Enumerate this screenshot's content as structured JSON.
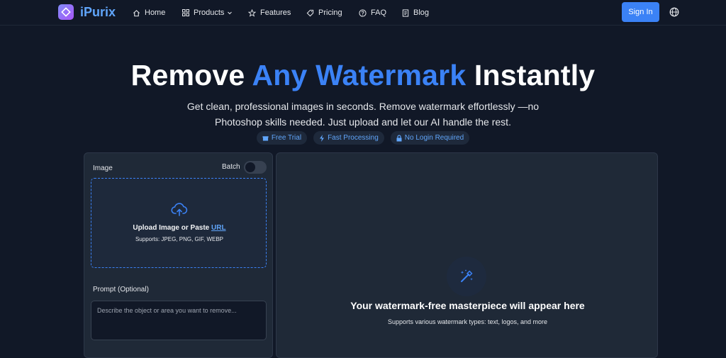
{
  "nav": {
    "brand": "iPurix",
    "links": [
      {
        "label": "Home",
        "icon": "home-icon"
      },
      {
        "label": "Products",
        "icon": "grid-icon"
      },
      {
        "label": "Features",
        "icon": "star-icon"
      },
      {
        "label": "Pricing",
        "icon": "tag-icon"
      },
      {
        "label": "FAQ",
        "icon": "help-circle-icon"
      },
      {
        "label": "Blog",
        "icon": "document-icon"
      }
    ],
    "signin": "Sign In"
  },
  "hero": {
    "title_pre": "Remove ",
    "title_accent": "Any Watermark",
    "title_post": " Instantly",
    "subtitle": "Get clean, professional images in seconds. Remove watermark effortlessly —no Photoshop skills needed. Just upload and let our AI handle the rest.",
    "badges": [
      {
        "label": "Free Trial",
        "icon": "gift-icon"
      },
      {
        "label": "Fast Processing",
        "icon": "bolt-icon"
      },
      {
        "label": "No Login Required",
        "icon": "lock-icon"
      }
    ]
  },
  "upload": {
    "image_label": "Image",
    "batch_label": "Batch",
    "dropzone_title": "Upload Image or Paste ",
    "dropzone_link": "URL",
    "dropzone_sub": "Supports: JPEG, PNG, GIF, WEBP",
    "prompt_label": "Prompt (Optional)",
    "prompt_placeholder": "Describe the object or area you want to remove..."
  },
  "result": {
    "title": "Your watermark-free masterpiece will appear here",
    "subtitle": "Supports various watermark types: text, logos, and more"
  },
  "colors": {
    "accent": "#3b82f6",
    "background": "#111827",
    "panel": "#1f2937"
  }
}
